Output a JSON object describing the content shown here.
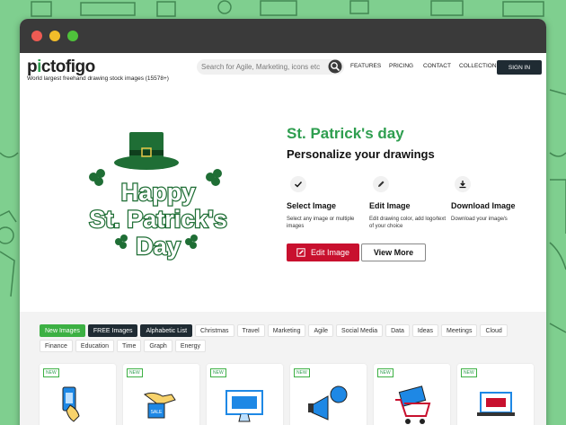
{
  "window": {
    "dots": [
      "close",
      "minimize",
      "maximize"
    ]
  },
  "header": {
    "logo": {
      "part1": "p",
      "accent": "i",
      "part2": "ctofigo"
    },
    "tagline": "World largest freehand drawing stock images  (15578+)",
    "search_placeholder": "Search for Agile, Marketing, icons etc",
    "nav": [
      "FEATURES",
      "PRICING",
      "CONTACT",
      "COLLECTION"
    ],
    "signin": "SIGN IN"
  },
  "hero": {
    "art_lines": [
      "Happy",
      "St. Patrick's",
      "Day"
    ],
    "title": "St. Patrick's day",
    "subtitle": "Personalize your drawings",
    "steps": [
      {
        "icon": "checkmark-icon",
        "title": "Select Image",
        "desc": "Select any image or multiple images"
      },
      {
        "icon": "pencil-icon",
        "title": "Edit Image",
        "desc": "Edit drawing color, add logo/text of your choice"
      },
      {
        "icon": "download-icon",
        "title": "Download Image",
        "desc": "Download your image/s"
      }
    ],
    "edit_button": "Edit Image",
    "more_button": "View More"
  },
  "gallery": {
    "tags": [
      {
        "label": "New Images",
        "style": "green"
      },
      {
        "label": "FREE Images",
        "style": "dark"
      },
      {
        "label": "Alphabetic List",
        "style": "dark"
      },
      {
        "label": "Christmas",
        "style": "plain"
      },
      {
        "label": "Travel",
        "style": "plain"
      },
      {
        "label": "Marketing",
        "style": "plain"
      },
      {
        "label": "Agile",
        "style": "plain"
      },
      {
        "label": "Social Media",
        "style": "plain"
      },
      {
        "label": "Data",
        "style": "plain"
      },
      {
        "label": "Ideas",
        "style": "plain"
      },
      {
        "label": "Meetings",
        "style": "plain"
      },
      {
        "label": "Cloud",
        "style": "plain"
      },
      {
        "label": "Finance",
        "style": "plain"
      },
      {
        "label": "Education",
        "style": "plain"
      },
      {
        "label": "Time",
        "style": "plain"
      },
      {
        "label": "Graph",
        "style": "plain"
      },
      {
        "label": "Energy",
        "style": "plain"
      }
    ],
    "badge": "NEW",
    "cards": [
      "phone-hand-icon",
      "card-hand-icon",
      "monitor-sale-icon",
      "megaphone-icon",
      "shopping-cart-icon",
      "laptop-sale-icon"
    ]
  },
  "colors": {
    "brand_green": "#2e9e4f",
    "edit_red": "#c8102e",
    "dark": "#1f2b33",
    "bg": "#7fcf8f"
  }
}
